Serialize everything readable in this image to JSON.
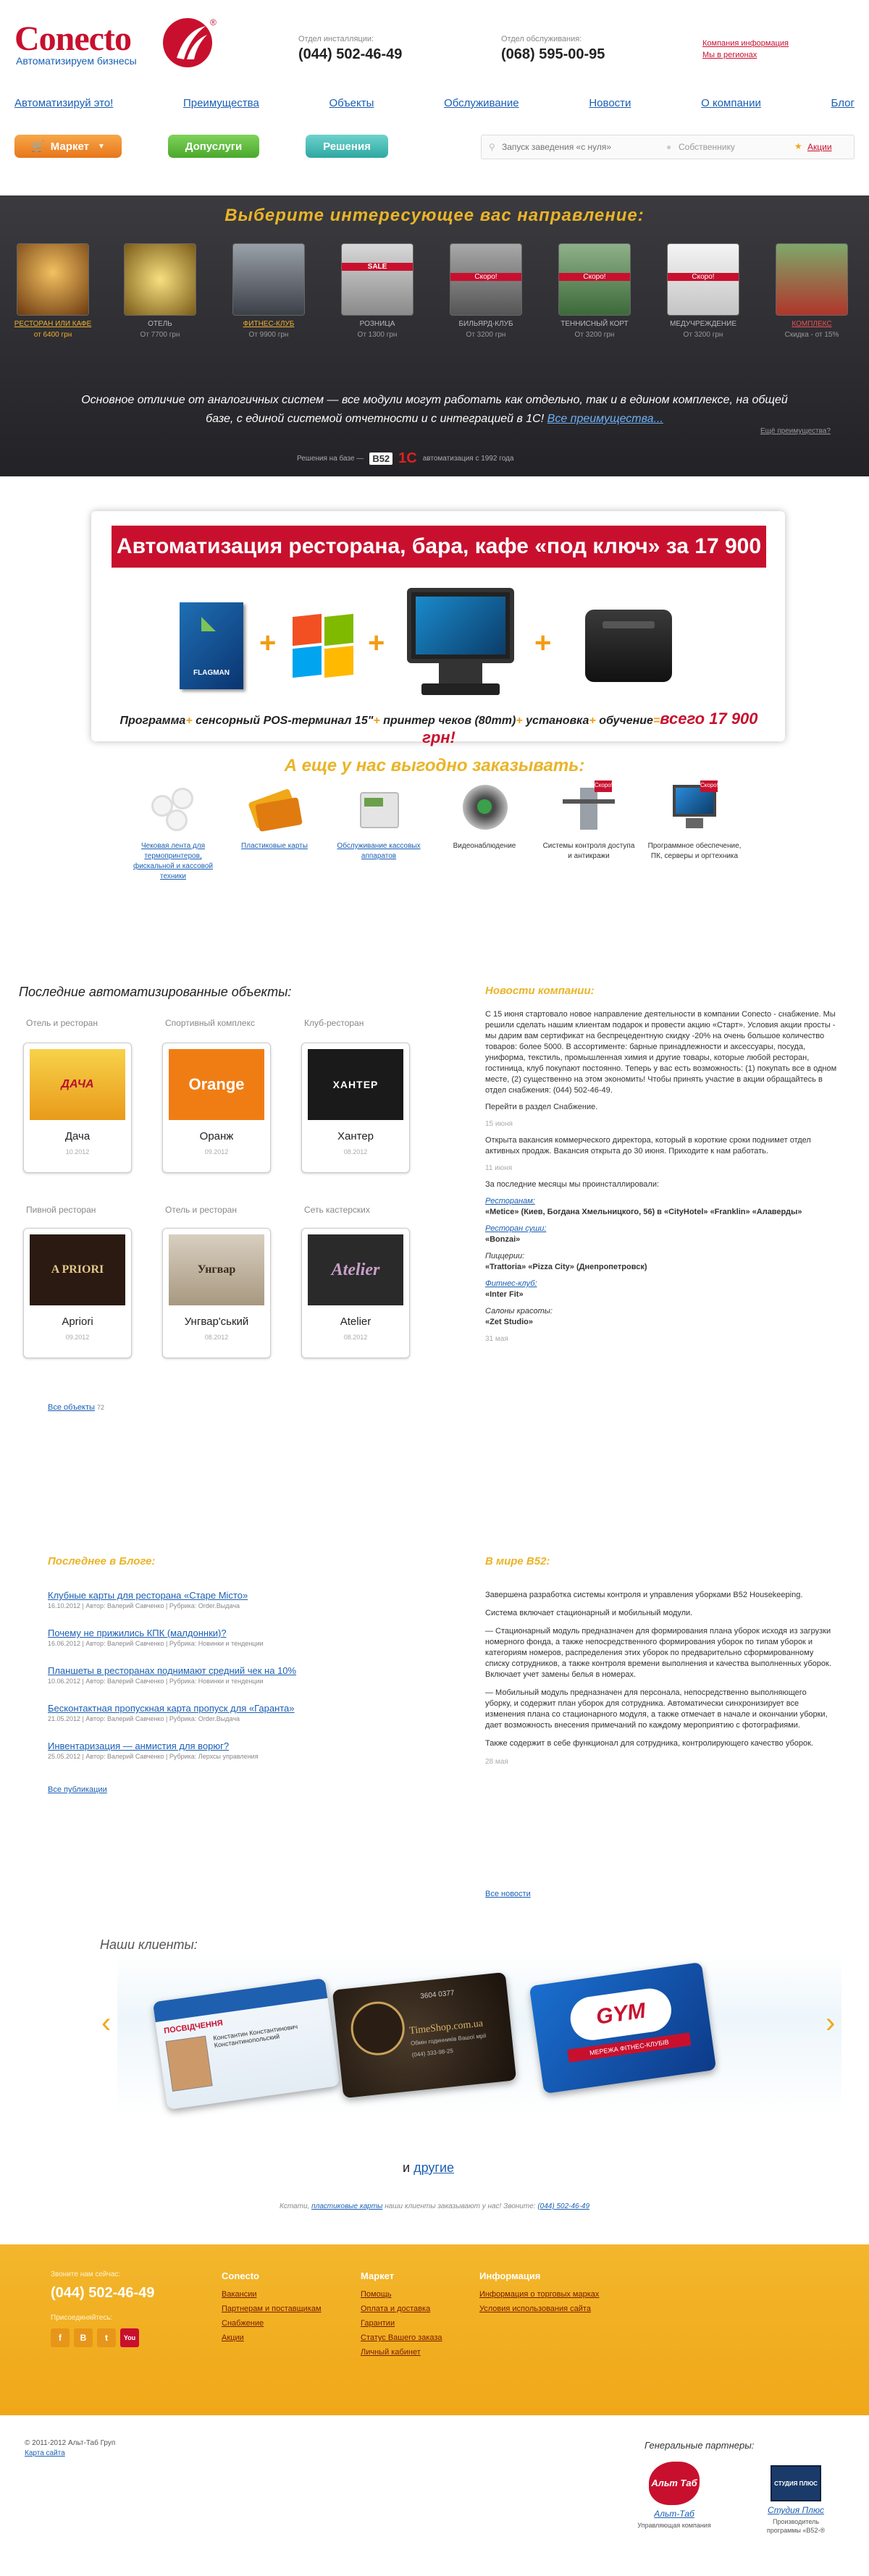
{
  "header": {
    "logo_text": "Conecto",
    "logo_tagline": "Автоматизируем бизнесы",
    "logo_mark": "®",
    "phone1_label": "Отдел инсталляции:",
    "phone1": "(044) 502-46-49",
    "phone2_label": "Отдел обслуживания:",
    "phone2": "(068) 595-00-95",
    "links": [
      "Компания информация",
      "Мы в регионах"
    ]
  },
  "nav": [
    "Автоматизируй это!",
    "Преимущества",
    "Объекты",
    "Обслуживание",
    "Новости",
    "О компании",
    "Блог"
  ],
  "buttons": {
    "market": "Маркет",
    "dopuslugi": "Допуслуги",
    "resheniya": "Решения"
  },
  "search": {
    "placeholder": "Запуск заведения «с нуля»",
    "own": "Собственнику",
    "actions": "Акции"
  },
  "directions": {
    "title": "Выберите интересующее вас направление:",
    "items": [
      {
        "name": "РЕСТОРАН ИЛИ КАФЕ",
        "price": "от 6400 грн"
      },
      {
        "name": "ОТЕЛЬ",
        "price": "От 7700 грн"
      },
      {
        "name": "ФИТНЕС-КЛУБ",
        "price": "От 9900 грн"
      },
      {
        "name": "РОЗНИЦА",
        "price": "От 1300 грн"
      },
      {
        "name": "БИЛЬЯРД-КЛУБ",
        "price": "От 3200 грн"
      },
      {
        "name": "ТЕННИСНЫЙ КОРТ",
        "price": "От 3200 грн"
      },
      {
        "name": "МЕДУЧРЕЖДЕНИЕ",
        "price": "От 3200 грн"
      },
      {
        "name": "КОМПЛЕКС",
        "price": "Скидка - от 15%"
      }
    ],
    "promo_tags": [
      "Скоро!"
    ],
    "text": "Основное отличие от аналогичных систем — все модули могут работать как отдельно, так и в едином комплексе, на общей базе, с единой системой отчетности и с интеграцией в 1С!",
    "more_link": "Все преимущества...",
    "compat": "Ещё преимущества?",
    "built_on": "Решения на базе —",
    "b52": "B52",
    "onec": "1С",
    "onec_note": "автоматизация с 1992 года"
  },
  "promo": {
    "title": "Автоматизация ресторана, бара, кафе «под ключ» за 17 900 грн!",
    "flagman": "FLAGMAN",
    "parts": [
      "Программа",
      "сенсорный POS-терминал 15\"",
      "принтер чеков (80mm)",
      "установка",
      "обучение"
    ],
    "plus": "+",
    "eq": "=",
    "total": "всего 17 900 грн!"
  },
  "also": {
    "title": "А еще у нас выгодно заказывать:",
    "items": [
      {
        "label": "Чековая лента для термопринтеров, фискальной и кассовой техники",
        "link": true
      },
      {
        "label": "Пластиковые карты",
        "link": true
      },
      {
        "label": "Обслуживание кассовых аппаратов",
        "link": true
      },
      {
        "label": "Видеонаблюдение",
        "link": false
      },
      {
        "label": "Системы контроля доступа и антикражи",
        "link": false
      },
      {
        "label": "Программное обеспечение, ПК, серверы и оргтехника",
        "link": false
      }
    ]
  },
  "objects": {
    "title": "Последние автоматизированные объекты:",
    "items": [
      {
        "cat": "Отель и ресторан",
        "name": "Дача",
        "date": "10.2012",
        "logo": "ДАЧА"
      },
      {
        "cat": "Спортивный комплекс",
        "name": "Оранж",
        "date": "09.2012",
        "logo": "Orange"
      },
      {
        "cat": "Клуб-ресторан",
        "name": "Хантер",
        "date": "08.2012",
        "logo": "ХАНТЕР"
      },
      {
        "cat": "Пивной ресторан",
        "name": "Apriori",
        "date": "09.2012",
        "logo": "A PRIORI"
      },
      {
        "cat": "Отель и ресторан",
        "name": "Унгвар'ський",
        "date": "08.2012",
        "logo": "Унгвар"
      },
      {
        "cat": "Сеть кастерских",
        "name": "Atelier",
        "date": "08.2012",
        "logo": "Atelier"
      }
    ],
    "all_link": "Все объекты",
    "all_count": "72"
  },
  "news": {
    "title": "Новости компании:",
    "p1": "С 15 июня стартовало новое направление деятельности в компании Conecto - снабжение. Мы решили сделать нашим клиентам подарок и провести акцию «Старт». Условия акции просты - мы дарим вам сертификат на беспрецедентную скидку -20% на очень большое количество товаров: более 5000. В ассортименте: барные принадлежности и аксессуары, посуда, униформа, текстиль, промышленная химия и другие товары, которые любой ресторан, гостиница, клуб покупают постоянно. Теперь у вас есть возможность: (1) покупать все в одном месте, (2) существенно на этом экономить! Чтобы принять участие в акции обращайтесь в отдел снабжения: (044) 502-46-49.",
    "p2": "Перейти в раздел Снабжение.",
    "d1": "15 июня",
    "p3": "Открыта вакансия коммерческого директора, который в короткие сроки поднимет отдел активных продаж. Вакансия открыта до 30 июня. Приходите к нам работать.",
    "d2": "11 июня",
    "p4": "За последние месяцы мы проинсталлировали:",
    "r1": "Ресторанам:",
    "r1v": "«Metiсе» (Киев, Богдана Хмельницкого, 56) в «CityHotel» «Franklin» «Алаверды»",
    "r2": "Ресторан суши:",
    "r2v": "«Bonzai»",
    "r3": "Пиццерии:",
    "r3v": "«Trattoria» «Pizza City» (Днепропетровск)",
    "r4": "Фитнес-клуб:",
    "r4v": "«Inter Fit»",
    "r5": "Салоны красоты:",
    "r5v": "«Zet Studio»",
    "d3": "31 мая"
  },
  "blog": {
    "title": "Последнее в Блоге:",
    "items": [
      {
        "t": "Клубные карты для ресторана «Старе Місто»",
        "m": "16.10.2012 | Автор: Валерий Савченко | Рубрика: Order.Выдача"
      },
      {
        "t": "Почему не прижились КПК (малдоннки)?",
        "m": "16.06.2012 | Автор: Валерий Савченко | Рубрика: Новинки и тенденции"
      },
      {
        "t": "Планшеты в ресторанах поднимают средний чек на 10%",
        "m": "10.06.2012 | Автор: Валерий Савченко | Рубрика: Новинки и тенденции"
      },
      {
        "t": "Бесконтактная пропускная карта пропуск для «Гаранта»",
        "m": "21.05.2012 | Автор: Валерий Савченко | Рубрика: Order.Выдача"
      },
      {
        "t": "Инвентаризация — анмистия для ворюг?",
        "m": "25.05.2012 | Автор: Валерий Савченко | Рубрика: Лерхсы управления"
      }
    ],
    "all_link": "Все публикации"
  },
  "b52news": {
    "title": "В мире В52:",
    "p1": "Завершена разработка системы контроля и управления уборками B52 Housekeeping.",
    "p2": "Система включает стационарный и мобильный модули.",
    "p3": "— Стационарный модуль предназначен для формирования плана уборок исходя из загрузки номерного фонда, а также непосредственного формирования уборок по типам уборок и категориям номеров, распределения этих уборок по предварительно сформированному списку сотрудников, а также контроля времени выполнения и качества выполненных уборок. Включает учет замены белья в номерах.",
    "p4": "— Мобильный модуль предназначен для персонала, непосредственно выполняющего уборку, и содержит план уборок для сотрудника. Автоматически синхронизирует все изменения плана со стационарного модуля, а также отмечает в начале и окончании уборки, дает возможность внесения примечаний по каждому мероприятию с фотографиями.",
    "p5": "Также содержит в себе функционал для сотрудника, контролирующего качество уборок.",
    "d": "28 мая",
    "all_link": "Все новости"
  },
  "clients": {
    "title": "Наши клиенты:",
    "card1_title": "ПОСВІДЧЕННЯ",
    "card1_name": "Константин Константинович Константинопольский",
    "card2_brand": "TimeShop.com.ua",
    "card2_sub": "Обмін годинників Вашої мрії",
    "card2_phone": "(044) 333-98-25",
    "card2_no": "3604 0377",
    "card3_brand": "GYM",
    "card3_sub": "МЕРЕЖА ФІТНЕС-КЛУБІВ",
    "and": "и",
    "others": "другие",
    "footnote_a": "Кстати,",
    "footnote_link": "пластиковые карты",
    "footnote_b": "наши клиенты заказывают у нас! Звоните:",
    "footnote_phone": "(044) 502-46-49"
  },
  "footer": {
    "phone_label": "Звоните нам сейчас:",
    "phone": "(044) 502-46-49",
    "social_label": "Присоединяйтесь:",
    "col1_h": "Conecto",
    "col1": [
      "Вакансии",
      "Партнерам и поставщикам",
      "Снабжение",
      "Акции"
    ],
    "col2_h": "Маркет",
    "col2": [
      "Помощь",
      "Оплата и доставка",
      "Гарантии",
      "Статус Вашего заказа",
      "Личный кабинет"
    ],
    "col3_h": "Информация",
    "col3": [
      "Информация о торговых марках",
      "Условия использования сайта"
    ],
    "copyright": "© 2011-2012 Альт-Таб Груп",
    "sitemap": "Карта сайта",
    "partners_title": "Генеральные партнеры:",
    "partner1": "Альт-Таб",
    "partner1_desc": "Управляющая компания",
    "partner1_logo": "Альт Таб",
    "partner2": "Студия Плюс",
    "partner2_desc": "Производитель программы «B52-®",
    "partner2_logo": "СТУДИЯ ПЛЮС"
  }
}
